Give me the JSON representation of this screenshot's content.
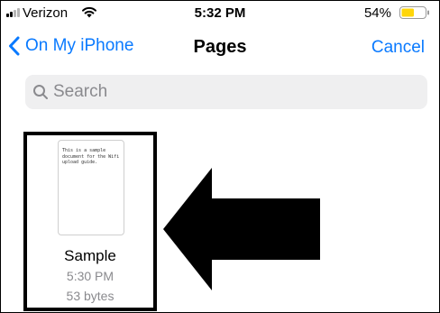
{
  "status_bar": {
    "carrier": "Verizon",
    "time": "5:32 PM",
    "battery_percent": "54%",
    "battery_level": 0.54,
    "battery_color": "#ffd60a"
  },
  "nav": {
    "back_label": "On My iPhone",
    "title": "Pages",
    "cancel_label": "Cancel",
    "accent_color": "#0a7aff"
  },
  "search": {
    "placeholder": "Search",
    "value": ""
  },
  "files": [
    {
      "name": "Sample",
      "time": "5:30 PM",
      "size": "53 bytes",
      "preview_text": "This is a sample document for the Wifi upload guide."
    }
  ],
  "icons": {
    "back": "chevron-left-icon",
    "search": "magnifier-icon",
    "wifi": "wifi-icon",
    "battery": "battery-icon",
    "signal": "signal-bars-icon",
    "annotation": "arrow-left-icon"
  }
}
